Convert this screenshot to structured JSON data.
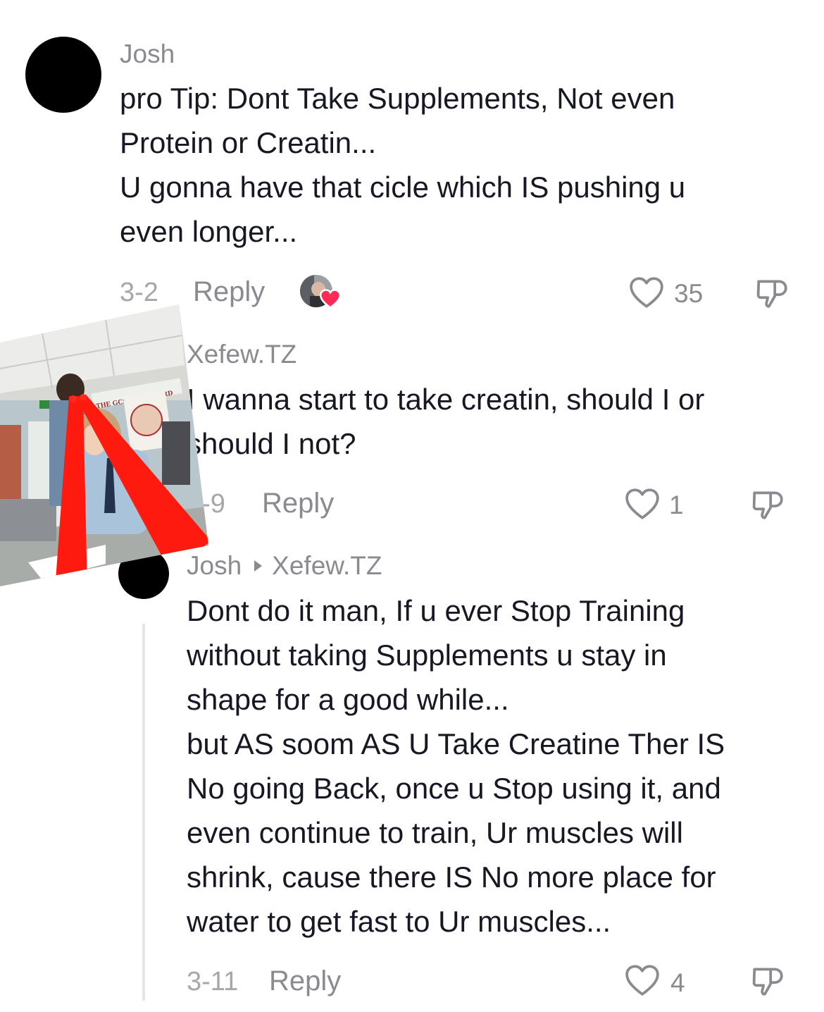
{
  "comments": [
    {
      "username": "Josh",
      "lines": [
        "pro Tip: Dont Take Supplements, Not even",
        "Protein or Creatin...",
        "U gonna have that cicle which IS pushing u",
        "even longer..."
      ],
      "date": "3-2",
      "reply_label": "Reply",
      "likes": "35"
    },
    {
      "username": "Xefew.TZ",
      "lines": [
        "I wanna start to take creatin, should I or",
        "should I not?"
      ],
      "date": "3-9",
      "reply_label": "Reply",
      "likes": "1"
    },
    {
      "username": "Josh",
      "reply_to": "Xefew.TZ",
      "lines": [
        "Dont do it man, If u ever Stop Training",
        "without taking Supplements u stay in",
        "shape for a good while...",
        "but AS soom AS U Take Creatine Ther IS",
        "No going Back, once u Stop using it, and",
        "even continue to train, Ur muscles will",
        "shrink, cause there IS No more place for",
        "water to get fast to Ur muscles..."
      ],
      "date": "3-11",
      "reply_label": "Reply",
      "likes": "4"
    }
  ],
  "overlay_photo": {
    "board_text": "THE GCSE IN... BOARD"
  },
  "colors": {
    "text": "#161823",
    "muted": "#8a8b91",
    "heart_badge": "#fe2c55",
    "laser": "#ff1a10"
  },
  "icons": [
    "heart-outline-icon",
    "thumbs-down-icon",
    "creator-liked-heart-icon",
    "reply-arrow-icon"
  ]
}
